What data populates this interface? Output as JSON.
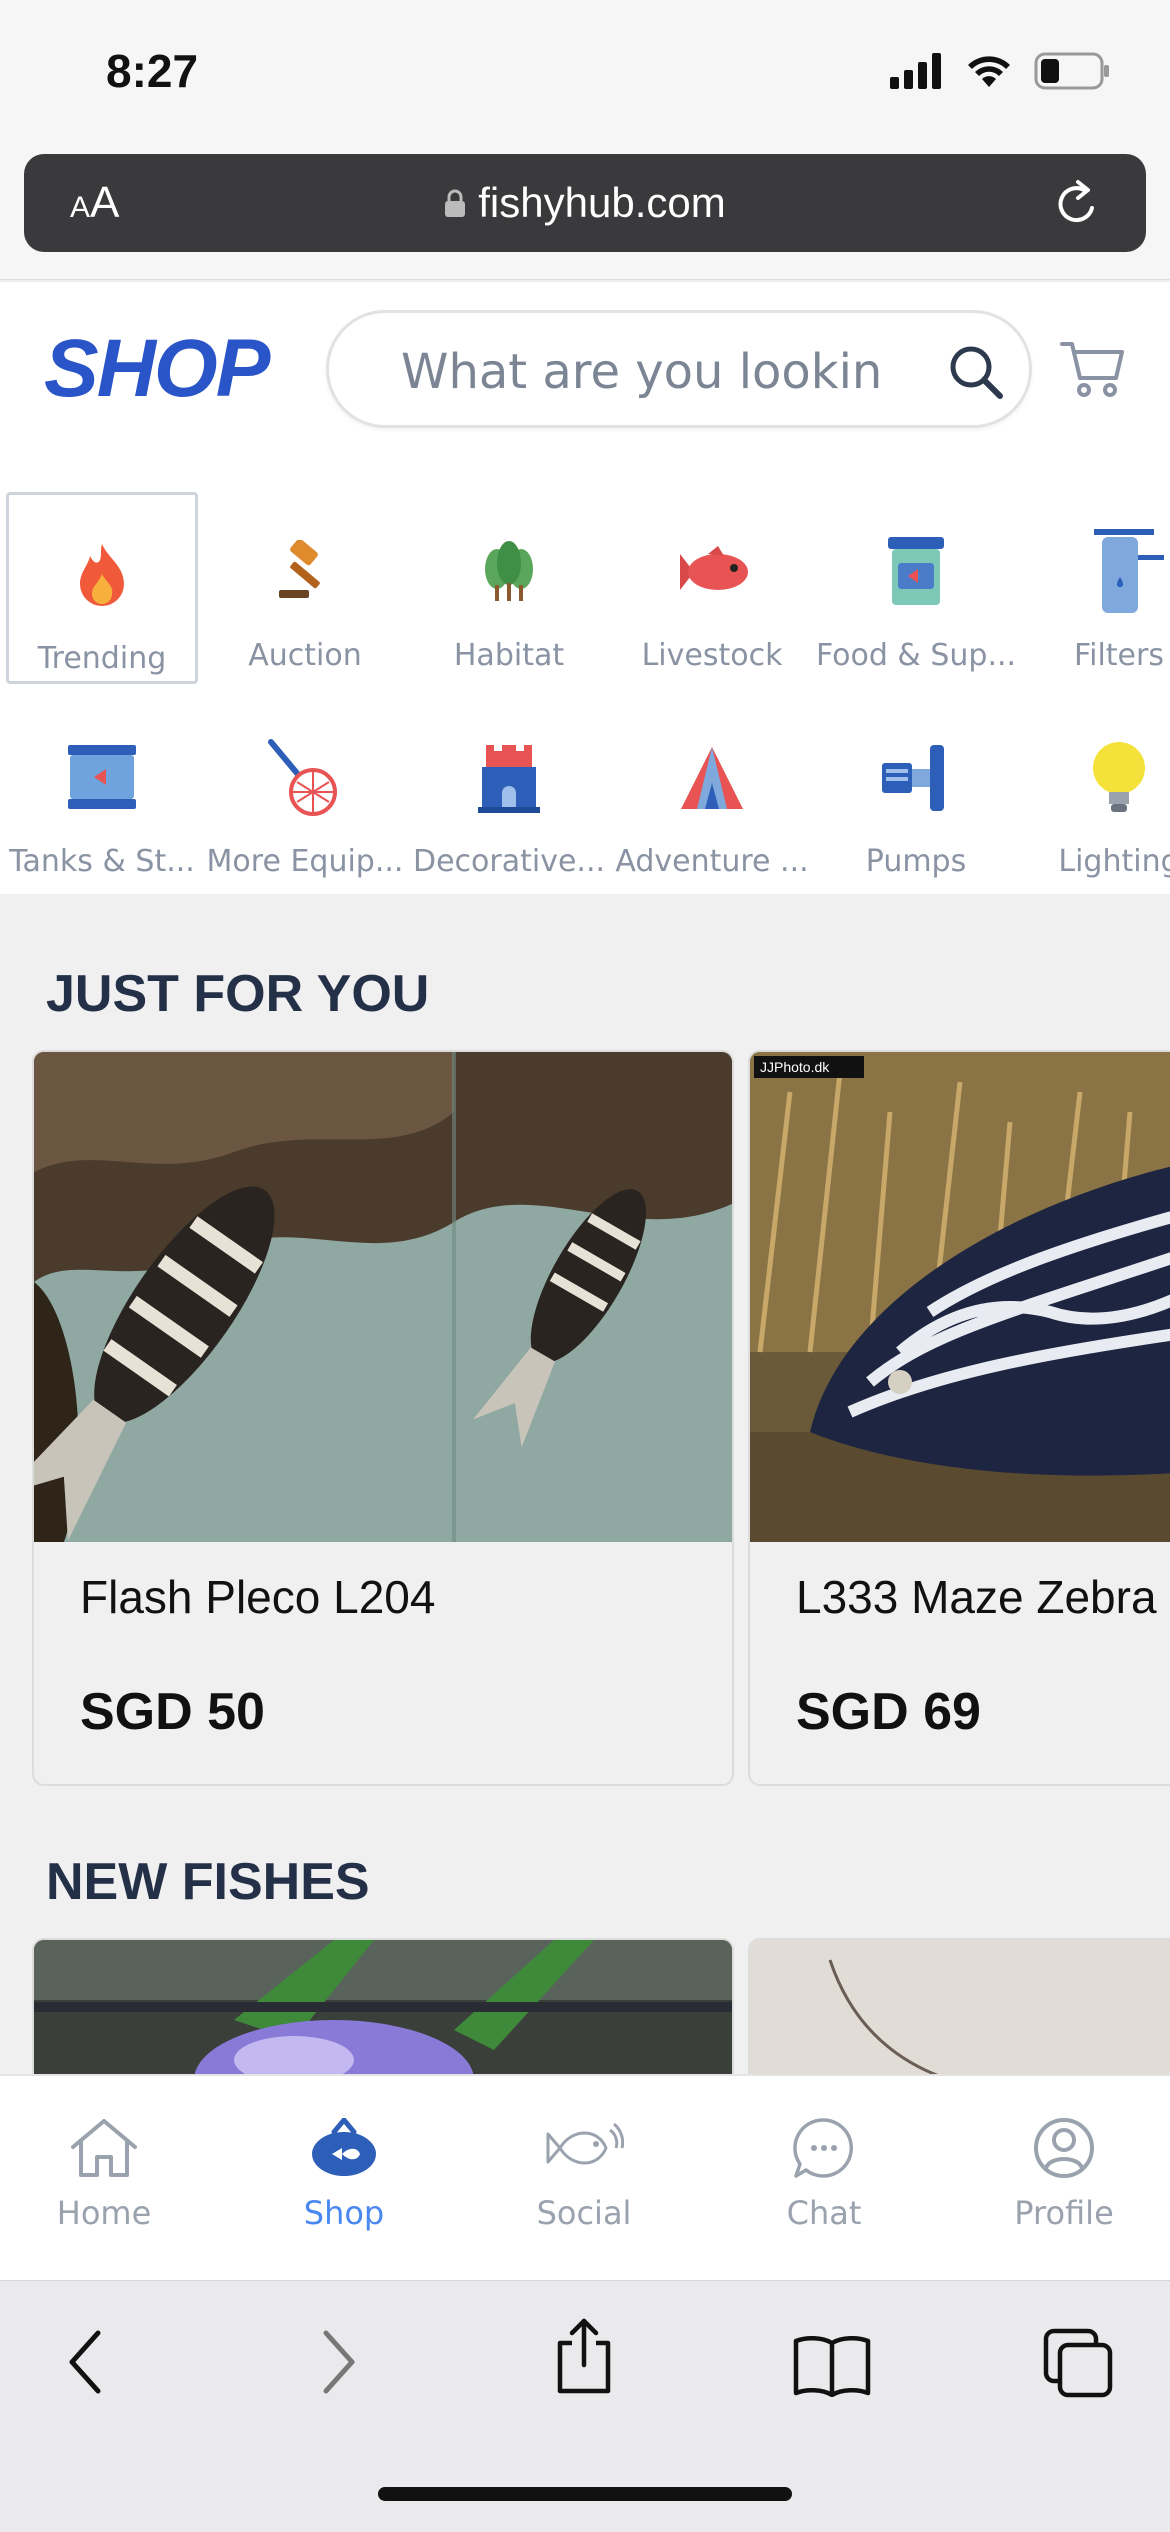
{
  "status_bar": {
    "time": "8:27"
  },
  "browser": {
    "aa_small": "A",
    "aa_big": "A",
    "url": "fishyhub.com"
  },
  "header": {
    "title": "SHOP",
    "search_placeholder": "What are you lookin"
  },
  "categories": [
    {
      "label": "Trending",
      "icon": "fire-icon"
    },
    {
      "label": "Auction",
      "icon": "gavel-icon"
    },
    {
      "label": "Habitat",
      "icon": "trees-icon"
    },
    {
      "label": "Livestock",
      "icon": "fish-icon"
    },
    {
      "label": "Food & Sup...",
      "icon": "food-jar-icon"
    },
    {
      "label": "Filters",
      "icon": "filter-icon"
    },
    {
      "label": "Tanks & St...",
      "icon": "tank-icon"
    },
    {
      "label": "More Equip...",
      "icon": "net-icon"
    },
    {
      "label": "Decorative...",
      "icon": "castle-icon"
    },
    {
      "label": "Adventure ...",
      "icon": "tent-icon"
    },
    {
      "label": "Pumps",
      "icon": "pump-icon"
    },
    {
      "label": "Lighting",
      "icon": "bulb-icon"
    }
  ],
  "just_for_you": {
    "title": "JUST FOR YOU",
    "items": [
      {
        "name": "Flash Pleco L204",
        "price": "SGD 50"
      },
      {
        "name": "L333 Maze Zebra",
        "price": "SGD 69",
        "photo_credit": "JJPhoto.dk"
      }
    ]
  },
  "new_fishes": {
    "title": "NEW FISHES"
  },
  "tab_bar": [
    {
      "label": "Home",
      "icon": "home-icon"
    },
    {
      "label": "Shop",
      "icon": "shop-fish-icon"
    },
    {
      "label": "Social",
      "icon": "social-fish-icon"
    },
    {
      "label": "Chat",
      "icon": "chat-icon"
    },
    {
      "label": "Profile",
      "icon": "profile-icon"
    }
  ],
  "colors": {
    "brand": "#2955c8",
    "active_tab": "#4a88f0",
    "muted_text": "#8a93a3",
    "heading": "#233048"
  }
}
